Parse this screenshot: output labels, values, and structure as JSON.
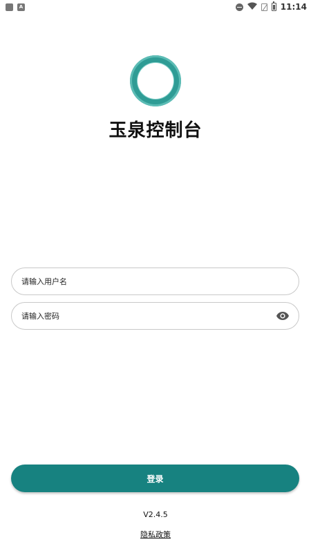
{
  "status_bar": {
    "time": "11:14",
    "icons": [
      "square-icon",
      "a-icon",
      "dnd-icon",
      "wifi-icon",
      "no-sim-icon",
      "battery-icon"
    ]
  },
  "app": {
    "title": "玉泉控制台",
    "logo": "ring-logo",
    "accent_color": "#178280",
    "logo_color": "#2f9c95"
  },
  "login_form": {
    "username_placeholder": "请输入用户名",
    "password_placeholder": "请输入密码",
    "submit_label": "登录"
  },
  "footer": {
    "version": "V2.4.5",
    "privacy_label": "隐私政策"
  }
}
